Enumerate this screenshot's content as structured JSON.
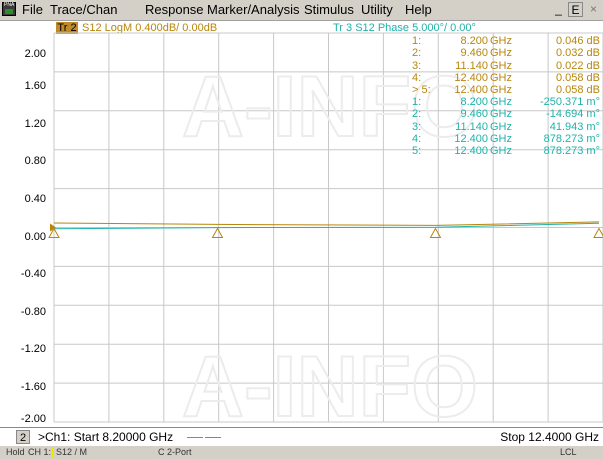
{
  "menu": [
    "File",
    "Trace/Chan",
    "Response",
    "Marker/Analysis",
    "Stimulus",
    "Utility",
    "Help"
  ],
  "window_controls": {
    "minimize": "_",
    "restore": "Е",
    "close": "×"
  },
  "app_icon_text": "PNA",
  "trace2": {
    "tag": "Tr 2",
    "label": "S12 LogM 0.400dB/  0.00dB",
    "color": "#b8860b"
  },
  "trace3": {
    "label": "Tr 3  S12 Phase 5.000°/  0.00°",
    "color": "#20b2aa"
  },
  "y_axis": [
    "2.00",
    "1.60",
    "1.20",
    "0.80",
    "0.40",
    "0.00",
    "-0.40",
    "-0.80",
    "-1.20",
    "-1.60",
    "-2.00"
  ],
  "markers_tr2": [
    {
      "id": "1:",
      "freq": "8.200",
      "unit": "GHz",
      "value": "0.046 dB"
    },
    {
      "id": "2:",
      "freq": "9.460",
      "unit": "GHz",
      "value": "0.032 dB"
    },
    {
      "id": "3:",
      "freq": "11.140",
      "unit": "GHz",
      "value": "0.022 dB"
    },
    {
      "id": "4:",
      "freq": "12.400",
      "unit": "GHz",
      "value": "0.058 dB"
    },
    {
      "id": "> 5:",
      "freq": "12.400",
      "unit": "GHz",
      "value": "0.058 dB"
    }
  ],
  "markers_tr3": [
    {
      "id": "1:",
      "freq": "8.200",
      "unit": "GHz",
      "value": "-250.371 m°"
    },
    {
      "id": "2:",
      "freq": "9.460",
      "unit": "GHz",
      "value": "-14.694 m°"
    },
    {
      "id": "3:",
      "freq": "11.140",
      "unit": "GHz",
      "value": "41.943 m°"
    },
    {
      "id": "4:",
      "freq": "12.400",
      "unit": "GHz",
      "value": "878.273 m°"
    },
    {
      "id": "5:",
      "freq": "12.400",
      "unit": "GHz",
      "value": "878.273 m°"
    }
  ],
  "watermark": "A-INFO",
  "footer": {
    "channel_num": "2",
    "start": ">Ch1: Start  8.20000 GHz",
    "stop": "Stop  12.4000 GHz"
  },
  "status": {
    "hold": "Hold",
    "ch": "CH 1:",
    "param": "S12 / M",
    "cal": "C  2-Port",
    "lcl": "LCL"
  },
  "chart_data": {
    "type": "line",
    "x_range_ghz": [
      8.2,
      12.4
    ],
    "ylim": [
      -2.0,
      2.0
    ],
    "series": [
      {
        "name": "Tr 2",
        "x": [
          8.2,
          9.46,
          11.14,
          12.4
        ],
        "values": [
          0.046,
          0.032,
          0.022,
          0.058
        ]
      },
      {
        "name": "Tr 3",
        "x": [
          8.2,
          9.46,
          11.14,
          12.4
        ],
        "values": [
          -0.25,
          -0.015,
          0.042,
          0.878
        ]
      }
    ]
  }
}
